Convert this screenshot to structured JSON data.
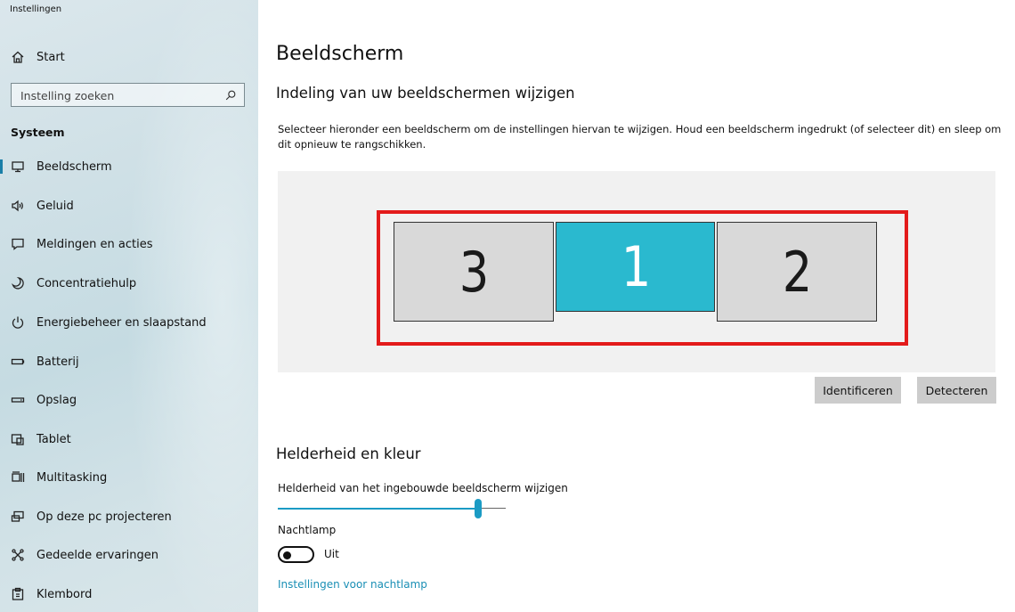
{
  "window": {
    "title": "Instellingen"
  },
  "sidebar": {
    "home_label": "Start",
    "search_placeholder": "Instelling zoeken",
    "section_label": "Systeem",
    "items": [
      {
        "label": "Beeldscherm",
        "icon": "monitor-icon",
        "active": true
      },
      {
        "label": "Geluid",
        "icon": "speaker-icon"
      },
      {
        "label": "Meldingen en acties",
        "icon": "notification-icon"
      },
      {
        "label": "Concentratiehulp",
        "icon": "moon-icon"
      },
      {
        "label": "Energiebeheer en slaapstand",
        "icon": "power-icon"
      },
      {
        "label": "Batterij",
        "icon": "battery-icon"
      },
      {
        "label": "Opslag",
        "icon": "storage-icon"
      },
      {
        "label": "Tablet",
        "icon": "tablet-icon"
      },
      {
        "label": "Multitasking",
        "icon": "multitasking-icon"
      },
      {
        "label": "Op deze pc projecteren",
        "icon": "project-icon"
      },
      {
        "label": "Gedeelde ervaringen",
        "icon": "shared-icon"
      },
      {
        "label": "Klembord",
        "icon": "clipboard-icon"
      }
    ]
  },
  "main": {
    "title": "Beeldscherm",
    "arrange_heading": "Indeling van uw beeldschermen wijzigen",
    "arrange_description": "Selecteer hieronder een beeldscherm om de instellingen hiervan te wijzigen. Houd een beeldscherm ingedrukt (of selecteer dit) en sleep om dit opnieuw te rangschikken.",
    "monitors": [
      {
        "number": "3",
        "selected": false
      },
      {
        "number": "1",
        "selected": true
      },
      {
        "number": "2",
        "selected": false
      }
    ],
    "identify_label": "Identificeren",
    "detect_label": "Detecteren",
    "brightness_heading": "Helderheid en kleur",
    "brightness_label": "Helderheid van het ingebouwde beeldscherm wijzigen",
    "brightness_value_percent": 88,
    "nightlight_label": "Nachtlamp",
    "nightlight_state": "Uit",
    "nightlight_settings_link": "Instellingen voor nachtlamp"
  },
  "colors": {
    "accent": "#1b9bc4",
    "selected_monitor": "#2ab9cf",
    "highlight_border": "#e31b1b",
    "link": "#1a8fb5"
  }
}
